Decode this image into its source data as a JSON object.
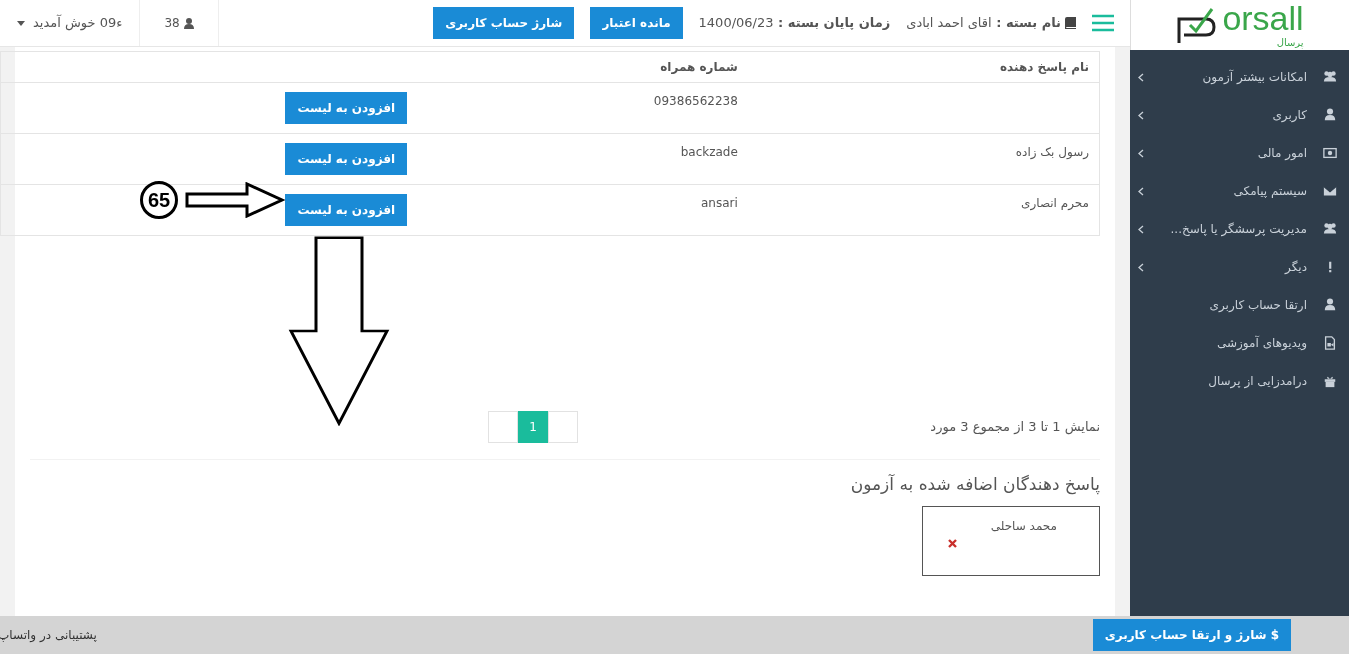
{
  "logo": {
    "text": "orsall",
    "subtitle": "پرسال"
  },
  "header": {
    "package_label": "نام بسته :",
    "package_name": "اقای احمد ابادی",
    "end_label": "زمان پایان بسته :",
    "end_date": "1400/06/23",
    "buttons": [
      "مانده اعتبار",
      "شارژ حساب کاربری"
    ],
    "user_count": "38",
    "welcome": "ء09 خوش آمدید"
  },
  "sidebar": {
    "items": [
      {
        "label": "امکانات بیشتر آزمون",
        "expandable": true
      },
      {
        "label": "کاربری",
        "expandable": true
      },
      {
        "label": "امور مالی",
        "expandable": true
      },
      {
        "label": "سیستم پیامکی",
        "expandable": true
      },
      {
        "label": "مدیریت پرسشگر یا پاسخ...",
        "expandable": true
      },
      {
        "label": "دیگر",
        "expandable": true
      },
      {
        "label": "ارتقا حساب کاربری",
        "expandable": false
      },
      {
        "label": "ویدیوهای آموزشی",
        "expandable": false
      },
      {
        "label": "درامدزایی از پرسال",
        "expandable": false
      }
    ]
  },
  "table": {
    "columns": [
      "نام پاسخ دهنده",
      "شماره همراه"
    ],
    "rows": [
      {
        "phone": "09386562238",
        "action": "افزودن به لیست"
      },
      {
        "name": "رسول بک زاده",
        "phone": "backzade",
        "action": "افزودن به لیست"
      },
      {
        "name": "محرم انصاری",
        "phone": "ansari",
        "action": "افزودن به لیست"
      }
    ]
  },
  "annotation": {
    "label": "65"
  },
  "pagination": {
    "info": "نمایش 1 تا 3 از مجموع 3 مورد",
    "pages": [
      {
        "label": "1",
        "selected": true
      }
    ]
  },
  "added": {
    "title": "پاسخ دهندگان اضافه شده به آزمون",
    "items": [
      {
        "name": "محمد ساحلی"
      }
    ]
  },
  "footer": {
    "support": "پشتیبانی در واتساپ",
    "upgrade_button": "$ شارژ و ارتقا حساب کاربری"
  }
}
